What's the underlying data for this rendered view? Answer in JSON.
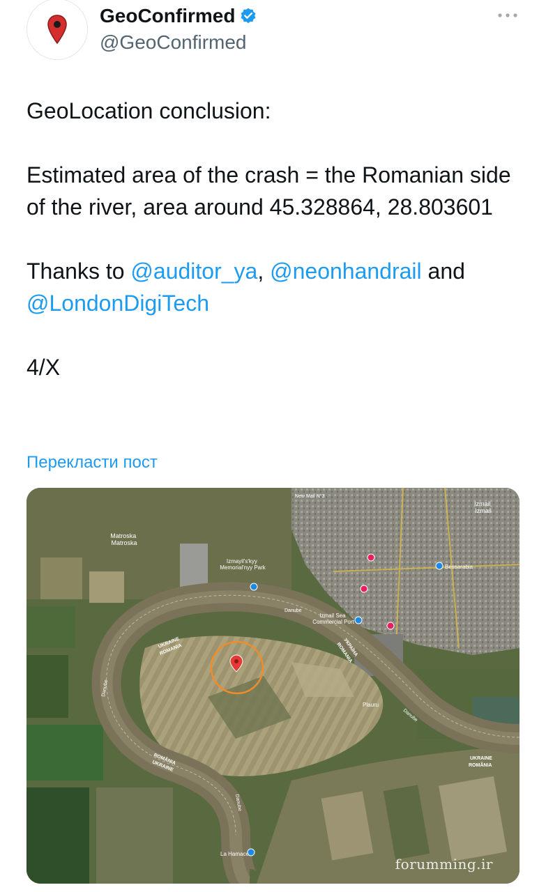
{
  "account": {
    "display_name": "GeoConfirmed",
    "handle": "@GeoConfirmed",
    "verified": true
  },
  "icons": {
    "avatar": "map-pin-icon",
    "verified": "verified-badge-icon",
    "more": "more-options-icon",
    "map_marker": "map-pin-icon"
  },
  "tweet": {
    "line1": "GeoLocation conclusion:",
    "line2": "Estimated area of the crash = the Romanian side of the river, area around 45.328864, 28.803601",
    "thanks_prefix": "Thanks to ",
    "mention1": "@auditor_ya",
    "sep": ", ",
    "mention2": "@neonhandrail",
    "and_text": " and ",
    "mention3": "@LondonDigiTech",
    "counter": "4/X"
  },
  "translate_link": "Перекласти пост",
  "map": {
    "labels": {
      "matroska": "Matroska\nMatroska",
      "park": "Izmayil's'kyy\nMemorial'nyy Park",
      "danube_top": "Danube",
      "port": "Izmail Sea\nCommercial Port",
      "bessarabia": "Bessarabia",
      "ukraine_left": "UKRAINE",
      "romania_left": "ROMANIA",
      "ukraine_right": "УКРАЇНА",
      "romania_right": "ROMANIA",
      "ukraine_br": "UKRAINE",
      "romania_br": "ROMÂNIA",
      "romania_bl": "ROMÂNIA",
      "ukraine_bl": "UKRAINE",
      "danube_left": "Danube",
      "danube_right": "Danube",
      "danube_bottom": "Danube",
      "plauru": "Plauru",
      "la_hamace": "La Hamace",
      "new_mail": "New Mail N°3",
      "izmail": "Izmail\nIzmail"
    },
    "colors": {
      "river": "#7b7359",
      "marker": "#e53935",
      "circle": "#f28c28",
      "fields_light": "#a49a76",
      "fields_dark": "#56663e",
      "city": "#8e8d83"
    }
  },
  "watermark": "forumming.ir"
}
